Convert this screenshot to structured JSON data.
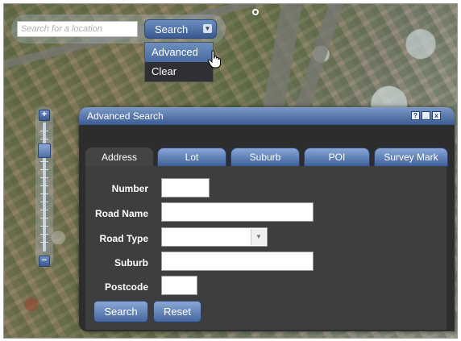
{
  "search": {
    "placeholder": "Search for a location",
    "button_label": "Search",
    "menu": [
      "Advanced",
      "Clear"
    ],
    "selected_menu_item": "Advanced"
  },
  "dialog": {
    "title": "Advanced Search",
    "title_buttons": [
      "?",
      "_",
      "x"
    ],
    "tabs": [
      "Address",
      "Lot",
      "Suburb",
      "POI",
      "Survey Mark"
    ],
    "active_tab": "Address",
    "fields": {
      "number": {
        "label": "Number",
        "value": ""
      },
      "road_name": {
        "label": "Road Name",
        "value": ""
      },
      "road_type": {
        "label": "Road Type",
        "value": ""
      },
      "suburb": {
        "label": "Suburb",
        "value": ""
      },
      "postcode": {
        "label": "Postcode",
        "value": ""
      }
    },
    "search_button": "Search",
    "reset_button": "Reset"
  },
  "zoom": {
    "plus": "+",
    "minus": "−"
  },
  "icons": {
    "dropdown": "chevron-down-icon",
    "help": "help-icon",
    "minimize": "minimize-icon",
    "close": "close-icon",
    "cursor": "hand-cursor-icon"
  },
  "colors": {
    "accent": "#4a6aa0",
    "dialog_bg": "#2d2d2d",
    "panel_bg": "#3e3e3e"
  }
}
